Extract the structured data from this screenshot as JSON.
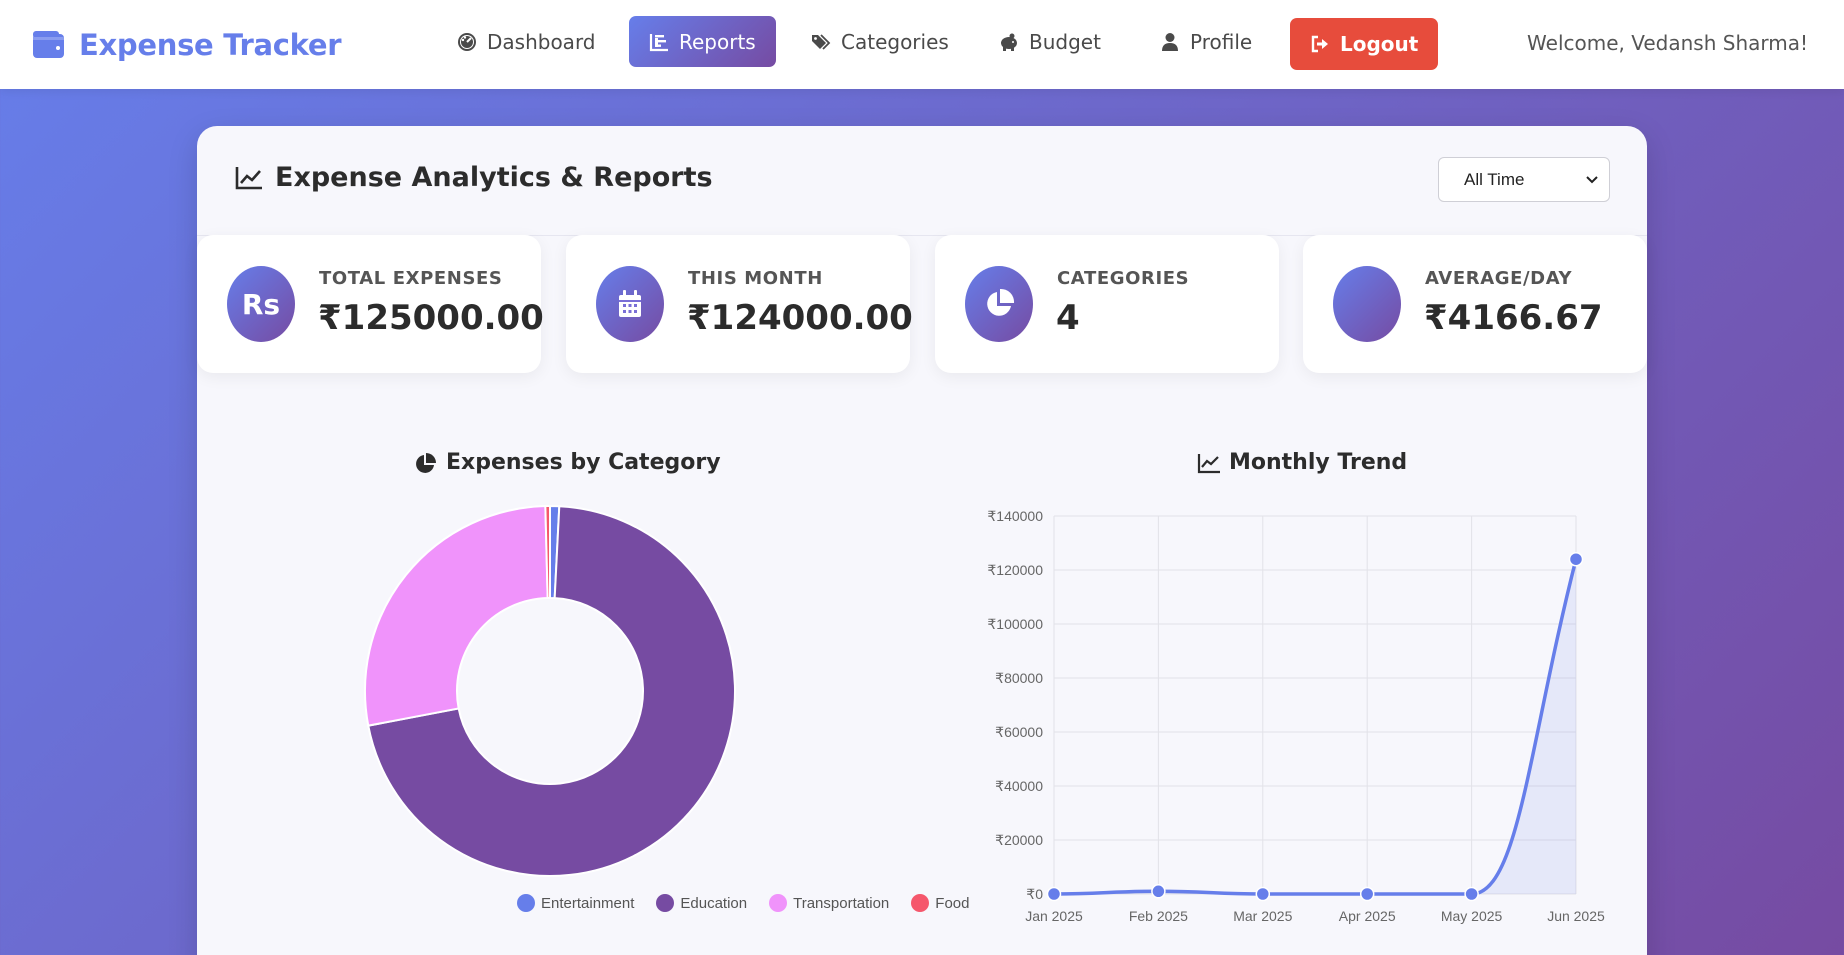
{
  "brand": {
    "name": "Expense Tracker",
    "icon": "wallet-icon",
    "color": "#667eea"
  },
  "nav": {
    "items": [
      {
        "label": "Dashboard",
        "icon": "gauge-icon"
      },
      {
        "label": "Reports",
        "icon": "bar-chart-icon",
        "active": true
      },
      {
        "label": "Categories",
        "icon": "tags-icon"
      },
      {
        "label": "Budget",
        "icon": "piggy-bank-icon"
      },
      {
        "label": "Profile",
        "icon": "user-icon"
      }
    ],
    "logout_label": "Logout",
    "logout_color": "#e74c3c"
  },
  "welcome": "Welcome, Vedansh Sharma!",
  "page": {
    "title": "Expense Analytics & Reports",
    "period_select": {
      "selected": "All Time"
    }
  },
  "stats": [
    {
      "label": "TOTAL EXPENSES",
      "value": "₹125000.00",
      "icon": "rupee-icon",
      "icon_text": "Rs"
    },
    {
      "label": "THIS MONTH",
      "value": "₹124000.00",
      "icon": "calendar-icon"
    },
    {
      "label": "CATEGORIES",
      "value": "4",
      "icon": "pie-chart-icon"
    },
    {
      "label": "AVERAGE/DAY",
      "value": "₹4166.67",
      "icon": "blank-icon"
    }
  ],
  "charts": {
    "category_title": "Expenses by Category",
    "trend_title": "Monthly Trend"
  },
  "chart_data": [
    {
      "type": "pie",
      "title": "Expenses by Category",
      "categories": [
        "Entertainment",
        "Education",
        "Transportation",
        "Food"
      ],
      "values": [
        1000,
        89000,
        34500,
        500
      ],
      "colors": [
        "#667eea",
        "#764ba2",
        "#f093fb",
        "#f5576c"
      ],
      "legend": "bottom"
    },
    {
      "type": "area",
      "title": "Monthly Trend",
      "x": [
        "Jan 2025",
        "Feb 2025",
        "Mar 2025",
        "Apr 2025",
        "May 2025",
        "Jun 2025"
      ],
      "values": [
        0,
        1000,
        0,
        0,
        0,
        124000
      ],
      "ylim": [
        0,
        140000
      ],
      "yticks": [
        "₹0",
        "₹20000",
        "₹40000",
        "₹60000",
        "₹80000",
        "₹100000",
        "₹120000",
        "₹140000"
      ],
      "ytick_values": [
        0,
        20000,
        40000,
        60000,
        80000,
        100000,
        120000,
        140000
      ],
      "color": "#667eea",
      "grid": true
    }
  ]
}
